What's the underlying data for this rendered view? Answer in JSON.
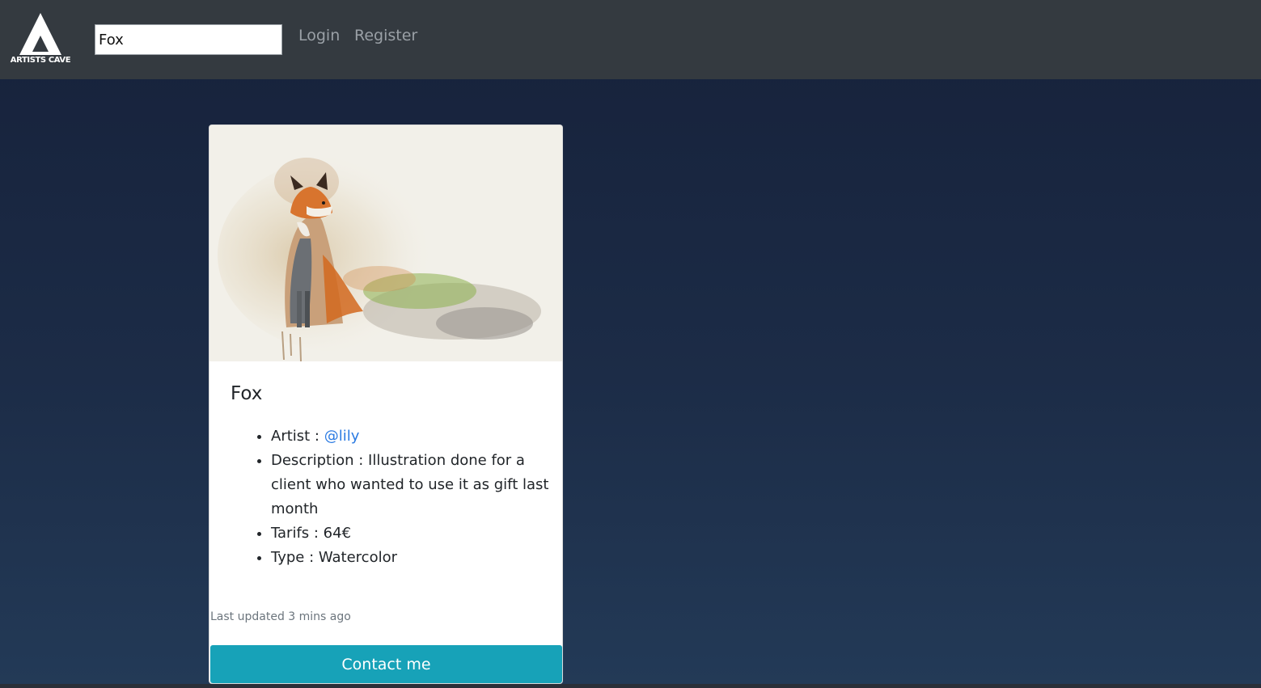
{
  "brand": {
    "logo_text": "ARTISTS CAVE"
  },
  "search": {
    "value": "Fox",
    "placeholder": ""
  },
  "nav": {
    "login_label": "Login",
    "register_label": "Register"
  },
  "card": {
    "title": "Fox",
    "artist_label": "Artist : ",
    "artist_handle": "@lily",
    "description_label": "Description : ",
    "description": "Illustration done for a client who wanted to use it as gift last month",
    "tarifs_label": "Tarifs : ",
    "tarifs_value": "64€",
    "type_label": "Type : ",
    "type_value": "Watercolor",
    "last_updated": "Last updated 3 mins ago",
    "contact_label": "Contact me",
    "image_alt": "watercolor-fox-illustration"
  },
  "colors": {
    "navbar_bg": "#343a40",
    "page_bg_top": "#16213a",
    "page_bg_bottom": "#233a57",
    "link": "#2a7ae2",
    "button_bg": "#17a2b8"
  }
}
